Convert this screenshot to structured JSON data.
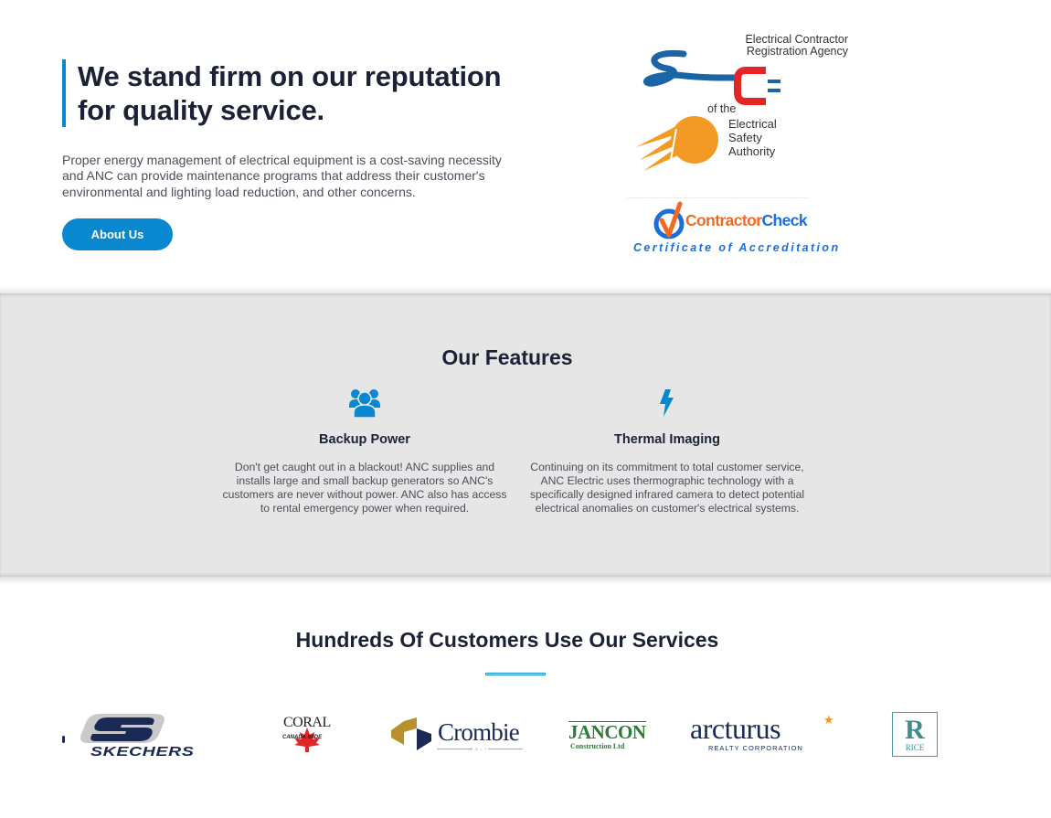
{
  "hero": {
    "title": "We stand firm on our reputation for quality service.",
    "body": "Proper energy management of electrical equipment is a cost-saving necessity and ANC can provide maintenance programs that address their customer's environmental and lighting load reduction, and other concerns.",
    "cta_label": "About Us"
  },
  "badges": {
    "ecra": {
      "top_line1": "Electrical Contractor",
      "top_line2": "Registration Agency",
      "of_the": "of the",
      "bottom_line1": "Electrical",
      "bottom_line2": "Safety",
      "bottom_line3": "Authority"
    },
    "contractor_check": {
      "name_part1": "Contractor",
      "name_part2": "Check",
      "subtitle": "Certificate of Accreditation"
    }
  },
  "features": {
    "title": "Our Features",
    "items": [
      {
        "icon": "users-icon",
        "name": "Backup Power",
        "description": "Don't get caught out in a blackout! ANC supplies and installs large and small backup generators so ANC's customers are never without power. ANC also has access to rental emergency power when required."
      },
      {
        "icon": "lightning-bolt-icon",
        "name": "Thermal Imaging",
        "description": "Continuing on its commitment to total customer service, ANC Electric uses thermographic technology with a specifically designed infrared camera to detect potential electrical anomalies on customer's electrical systems."
      }
    ]
  },
  "customers": {
    "title": "Hundreds Of Customers Use Our Services",
    "logos": [
      {
        "name": "Skechers",
        "text": "SKECHERS"
      },
      {
        "name": "Coral Canada Wide",
        "text": "CORAL",
        "sub": "CANADA WIDE"
      },
      {
        "name": "Crombie REIT",
        "text": "Crombie",
        "sub": "REIT"
      },
      {
        "name": "Jancon Construction Ltd",
        "text": "JANCON",
        "sub": "Construction Ltd"
      },
      {
        "name": "Arcturus Realty Corporation",
        "text": "arcturus",
        "sub": "REALTY CORPORATION"
      },
      {
        "name": "Rice",
        "text": "R",
        "sub": "RICE"
      }
    ]
  },
  "colors": {
    "accent": "#0a88cf",
    "heading": "#1b2236",
    "body_text": "#4a4f5a",
    "band_bg": "#e6e6e6"
  }
}
